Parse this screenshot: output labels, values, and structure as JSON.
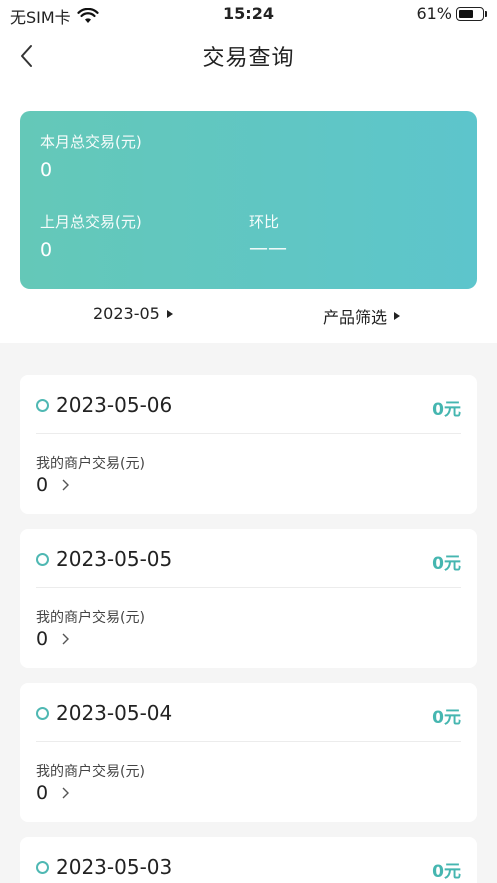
{
  "status_bar": {
    "carrier": "无SIM卡",
    "time": "15:24",
    "battery": "61%"
  },
  "nav": {
    "title": "交易查询"
  },
  "summary": {
    "this_month_label": "本月总交易(元)",
    "this_month_value": "0",
    "last_month_label": "上月总交易(元)",
    "last_month_value": "0",
    "mom_label": "环比",
    "mom_value": "——"
  },
  "filters": {
    "month": "2023-05",
    "product": "产品筛选"
  },
  "days": [
    {
      "date": "2023-05-06",
      "amount": "0元",
      "merchant_label": "我的商户交易(元)",
      "merchant_value": "0"
    },
    {
      "date": "2023-05-05",
      "amount": "0元",
      "merchant_label": "我的商户交易(元)",
      "merchant_value": "0"
    },
    {
      "date": "2023-05-04",
      "amount": "0元",
      "merchant_label": "我的商户交易(元)",
      "merchant_value": "0"
    },
    {
      "date": "2023-05-03",
      "amount": "0元"
    }
  ],
  "colors": {
    "accent": "#45b6b0",
    "card_gradient_start": "#64c8b8",
    "card_gradient_end": "#5dc5cc"
  }
}
